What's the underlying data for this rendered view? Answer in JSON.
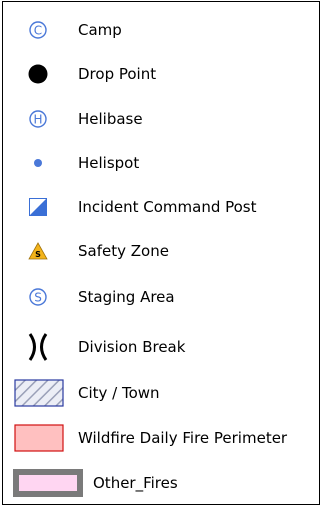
{
  "legend": {
    "items": [
      {
        "label": "Camp",
        "icon": "circled-c-icon",
        "color": "#4a78d8"
      },
      {
        "label": "Drop Point",
        "icon": "filled-circle-icon",
        "color": "#000000"
      },
      {
        "label": "Helibase",
        "icon": "circled-h-icon",
        "color": "#4a78d8"
      },
      {
        "label": "Helispot",
        "icon": "small-dot-icon",
        "color": "#4a78d8"
      },
      {
        "label": "Incident Command Post",
        "icon": "half-square-icon",
        "color": "#3a6fd6"
      },
      {
        "label": "Safety Zone",
        "icon": "safety-triangle-icon",
        "color": "#f3b41b"
      },
      {
        "label": "Staging Area",
        "icon": "circled-s-icon",
        "color": "#4a78d8"
      },
      {
        "label": "Division Break",
        "icon": "division-break-icon",
        "color": "#000000"
      },
      {
        "label": "City / Town",
        "icon": "hatched-box-icon",
        "color": "#b7bfe0"
      },
      {
        "label": "Wildfire Daily Fire Perimeter",
        "icon": "red-box-icon",
        "color": "#ffc0c0"
      },
      {
        "label": "Other_Fires",
        "icon": "pink-box-icon",
        "color": "#ffd6f2"
      }
    ]
  }
}
